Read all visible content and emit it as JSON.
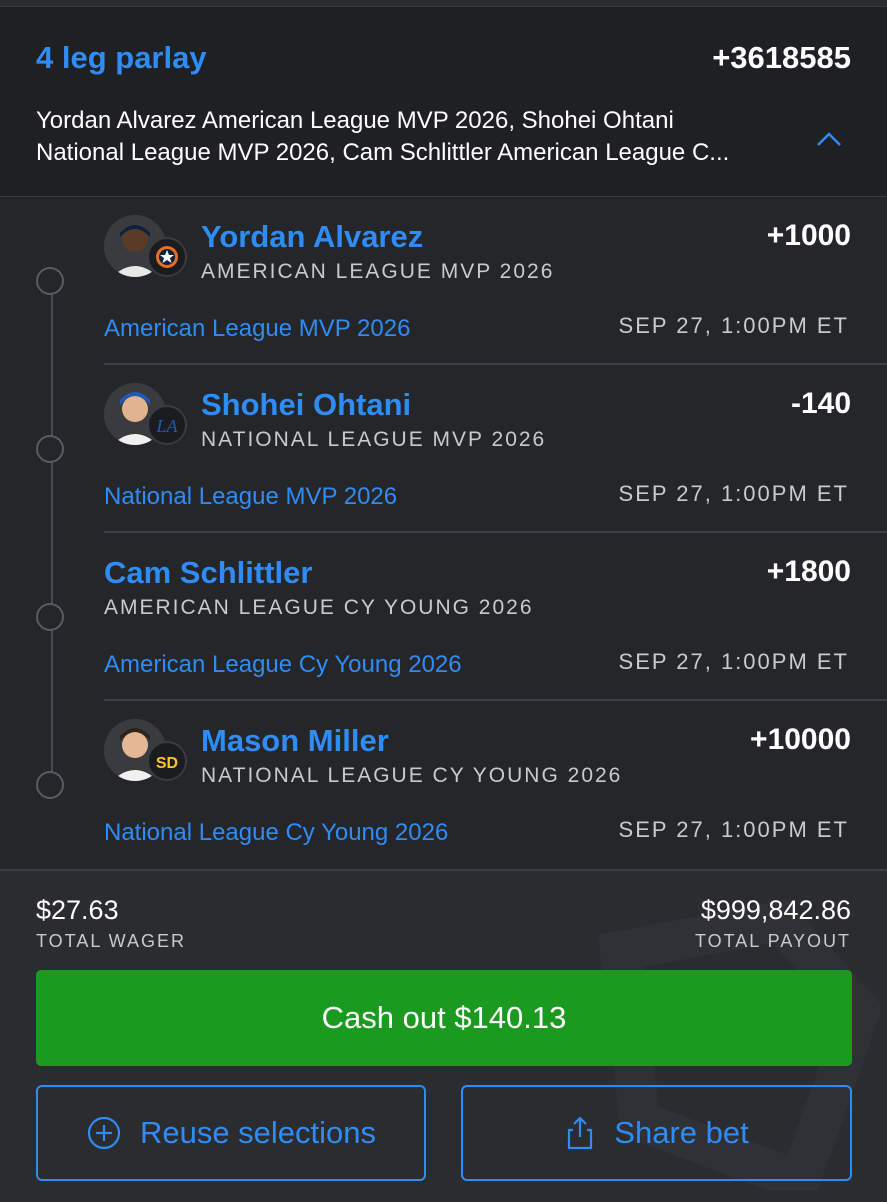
{
  "parlay": {
    "title": "4 leg parlay",
    "odds": "+3618585",
    "summary_line1": "Yordan Alvarez American League MVP 2026, Shohei Ohtani",
    "summary_line2": "National League MVP 2026, Cam Schlittler American League C...",
    "collapse_icon": "chevron-up-icon"
  },
  "legs": [
    {
      "player": "Yordan Alvarez",
      "market": "AMERICAN LEAGUE MVP 2026",
      "odds": "+1000",
      "event": "American League MVP 2026",
      "time": "SEP 27, 1:00PM ET",
      "avatar": true,
      "team": "Astros"
    },
    {
      "player": "Shohei Ohtani",
      "market": "NATIONAL LEAGUE MVP 2026",
      "odds": "-140",
      "event": "National League MVP 2026",
      "time": "SEP 27, 1:00PM ET",
      "avatar": true,
      "team": "Dodgers"
    },
    {
      "player": "Cam Schlittler",
      "market": "AMERICAN LEAGUE CY YOUNG 2026",
      "odds": "+1800",
      "event": "American League Cy Young 2026",
      "time": "SEP 27, 1:00PM ET",
      "avatar": false
    },
    {
      "player": "Mason Miller",
      "market": "NATIONAL LEAGUE CY YOUNG 2026",
      "odds": "+10000",
      "event": "National League Cy Young 2026",
      "time": "SEP 27, 1:00PM ET",
      "avatar": true,
      "team": "Padres"
    }
  ],
  "footer": {
    "total_wager": "$27.63",
    "total_wager_label": "TOTAL WAGER",
    "total_payout": "$999,842.86",
    "total_payout_label": "TOTAL PAYOUT",
    "cashout_label": "Cash out $140.13",
    "reuse_label": "Reuse selections",
    "share_label": "Share bet"
  },
  "colors": {
    "accent": "#2f8cf5",
    "cashout_green": "#1a9a1f",
    "background": "#1f2023"
  }
}
